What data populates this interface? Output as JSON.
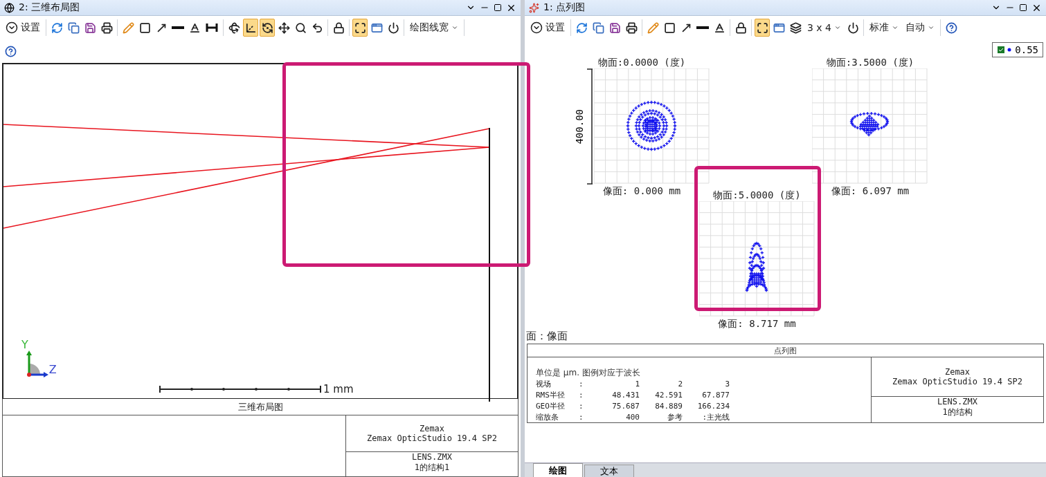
{
  "panes": [
    {
      "title": "2: 三维布局图",
      "toolbar_rows": [
        [
          {
            "kind": "settings",
            "label": "设置"
          },
          {
            "kind": "sep"
          },
          {
            "kind": "refresh",
            "selected": false
          },
          {
            "kind": "copy",
            "selected": false
          },
          {
            "kind": "save",
            "selected": false
          },
          {
            "kind": "print",
            "selected": false
          },
          {
            "kind": "sep"
          },
          {
            "kind": "pencil",
            "selected": false
          },
          {
            "kind": "rect",
            "selected": false
          },
          {
            "kind": "arrow",
            "selected": false
          },
          {
            "kind": "line",
            "selected": false
          },
          {
            "kind": "letter",
            "selected": false
          },
          {
            "kind": "dimension",
            "selected": false
          },
          {
            "kind": "sep"
          },
          {
            "kind": "rotate3d",
            "selected": false
          },
          {
            "kind": "axes",
            "selected": true
          },
          {
            "kind": "view",
            "selected": true
          },
          {
            "kind": "pan",
            "selected": false
          },
          {
            "kind": "zoom",
            "selected": false
          },
          {
            "kind": "reset",
            "selected": false
          },
          {
            "kind": "sep"
          },
          {
            "kind": "lock",
            "selected": false
          },
          {
            "kind": "sep"
          },
          {
            "kind": "fit",
            "selected": true
          },
          {
            "kind": "window",
            "selected": false
          },
          {
            "kind": "power",
            "selected": false
          },
          {
            "kind": "sep"
          },
          {
            "kind": "dropdown",
            "label": "绘图线宽"
          },
          {
            "kind": "sep"
          }
        ],
        [
          {
            "kind": "help",
            "selected": false
          }
        ]
      ],
      "layout": {
        "axis_labels": [
          "Y",
          "Z"
        ],
        "scale_label": "1 mm",
        "heading": "三维布局图",
        "cells": [
          [
            "Zemax",
            "Zemax OpticStudio 19.4 SP2"
          ],
          [
            "LENS.ZMX",
            "1的结构1"
          ]
        ]
      }
    },
    {
      "title": "1: 点列图",
      "toolbar_rows": [
        [
          {
            "kind": "settings",
            "label": "设置"
          },
          {
            "kind": "sep"
          },
          {
            "kind": "refresh",
            "selected": false
          },
          {
            "kind": "copy",
            "selected": false
          },
          {
            "kind": "save",
            "selected": false
          },
          {
            "kind": "print",
            "selected": false
          },
          {
            "kind": "sep"
          },
          {
            "kind": "pencil",
            "selected": false
          },
          {
            "kind": "rect",
            "selected": false
          },
          {
            "kind": "arrow",
            "selected": false
          },
          {
            "kind": "line",
            "selected": false
          },
          {
            "kind": "letter",
            "selected": false
          },
          {
            "kind": "sep"
          },
          {
            "kind": "lock",
            "selected": false
          },
          {
            "kind": "sep"
          },
          {
            "kind": "fit",
            "selected": true
          },
          {
            "kind": "window",
            "selected": false
          },
          {
            "kind": "layers",
            "selected": false
          },
          {
            "kind": "dropdown",
            "label": "3 x 4"
          },
          {
            "kind": "power",
            "selected": false
          },
          {
            "kind": "sep"
          },
          {
            "kind": "dropdown",
            "label": "标准"
          },
          {
            "kind": "dropdown",
            "label": "自动"
          },
          {
            "kind": "sep"
          },
          {
            "kind": "help",
            "selected": false
          }
        ]
      ],
      "spot": {
        "legend": "0.55",
        "scale_label": "400.00",
        "fields": [
          {
            "object": "物面:0.0000 (度)",
            "image": "像面: 0.000 mm"
          },
          {
            "object": "物面:3.5000 (度)",
            "image": "像面: 6.097 mm"
          },
          {
            "object": "物面:5.0000 (度)",
            "image": "像面: 8.717 mm"
          }
        ],
        "surface": "面：像面",
        "heading": "点列图",
        "note": "单位是 μm. 图例对应于波长",
        "rows": [
          [
            "视场",
            ":",
            "1",
            "2",
            "3"
          ],
          [
            "RMS半径",
            ":",
            "48.431",
            "42.591",
            "67.877"
          ],
          [
            "GEO半径",
            ":",
            "75.687",
            "84.889",
            "166.234"
          ],
          [
            "缩放条",
            ":",
            "400",
            "参考",
            ":主光线"
          ]
        ],
        "cells": [
          [
            "Zemax",
            "Zemax OpticStudio 19.4 SP2"
          ],
          [
            "LENS.ZMX",
            "1的结构"
          ]
        ],
        "tabs": [
          {
            "label": "绘图",
            "selected": true
          },
          {
            "label": "文本",
            "selected": false
          }
        ]
      }
    }
  ]
}
